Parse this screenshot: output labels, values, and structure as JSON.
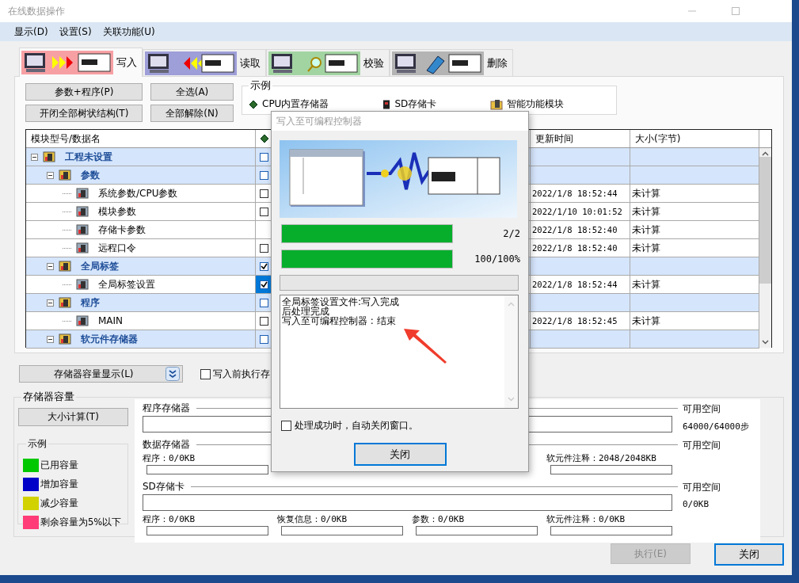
{
  "window": {
    "title": "在线数据操作"
  },
  "menu": [
    "显示(D)",
    "设置(S)",
    "关联功能(U)"
  ],
  "tabs": [
    {
      "label": "写入",
      "kind": "write",
      "color": "#f7a0a4",
      "selected": true
    },
    {
      "label": "读取",
      "kind": "read",
      "color": "#9e9ed8",
      "selected": false
    },
    {
      "label": "校验",
      "kind": "verify",
      "color": "#a2d4a2",
      "selected": false
    },
    {
      "label": "删除",
      "kind": "delete",
      "color": "#b4b4b4",
      "selected": false
    }
  ],
  "buttons": [
    "参数+程序(P)",
    "全选(A)",
    "开闭全部树状结构(T)",
    "全部解除(N)"
  ],
  "legend": {
    "title": "示例",
    "items": [
      {
        "label": "CPU内置存储器",
        "kind": "cpu"
      },
      {
        "label": "SD存储卡",
        "kind": "sd"
      },
      {
        "label": "智能功能模块",
        "kind": "module"
      }
    ]
  },
  "tree": {
    "columns": [
      "模块型号/数据名",
      "更新时间",
      "大小(字节)"
    ],
    "rows": [
      {
        "name": "工程未设置",
        "kind": "group",
        "expanded": true,
        "checked": false,
        "selected": false,
        "children": [
          {
            "name": "参数",
            "kind": "group",
            "expanded": true,
            "checked": false,
            "selected": false,
            "children": [
              {
                "name": "系统参数/CPU参数",
                "kind": "item",
                "checked": false,
                "selected": false,
                "updated": "2022/1/8 18:52:44",
                "size": "未计算"
              },
              {
                "name": "模块参数",
                "kind": "item",
                "checked": false,
                "selected": false,
                "updated": "2022/1/10 10:01:52",
                "size": "未计算"
              },
              {
                "name": "存储卡参数",
                "kind": "item",
                "selected": false,
                "updated": "2022/1/8 18:52:40",
                "size": "未计算"
              },
              {
                "name": "远程口令",
                "kind": "item",
                "checked": false,
                "selected": false,
                "updated": "2022/1/8 18:52:40",
                "size": "未计算"
              }
            ]
          },
          {
            "name": "全局标签",
            "kind": "group",
            "expanded": true,
            "checked": true,
            "selected": false,
            "children": [
              {
                "name": "全局标签设置",
                "kind": "item",
                "checked": true,
                "selected": true,
                "updated": "2022/1/8 18:52:44",
                "size": "未计算"
              }
            ]
          },
          {
            "name": "程序",
            "kind": "group",
            "expanded": true,
            "checked": false,
            "selected": false,
            "children": [
              {
                "name": "MAIN",
                "kind": "item",
                "checked": false,
                "selected": false,
                "updated": "2022/1/8 18:52:45",
                "size": "未计算"
              }
            ]
          },
          {
            "name": "软元件存储器",
            "kind": "group",
            "expanded": true,
            "checked": false,
            "selected": false
          }
        ]
      }
    ]
  },
  "capacity_toggle": {
    "label": "存储器容量显示(L)"
  },
  "pre_write_option": {
    "label": "写入前执行存",
    "checked": false
  },
  "capacity": {
    "title": "存储器容量",
    "calc_button": "大小计算(T)",
    "legend": {
      "title": "示例",
      "items": [
        {
          "label": "已用容量",
          "color": "#00c800"
        },
        {
          "label": "增加容量",
          "color": "#0000c8"
        },
        {
          "label": "减少容量",
          "color": "#d2d200"
        },
        {
          "label": "剩余容量为5%以下",
          "color": "#ff3c78"
        }
      ]
    },
    "sections": [
      {
        "title": "程序存储器",
        "kind": "bar",
        "free_label": "可用空间",
        "free_value": "64000/64000步"
      },
      {
        "title": "数据存储器",
        "kind": "list",
        "free_label": "可用空间",
        "items": [
          {
            "label": "程序：0/0KB"
          },
          {
            "label": "软元件注释：2048/2048KB"
          }
        ]
      },
      {
        "title": "SD存储卡",
        "kind": "bar",
        "free_label": "可用空间",
        "free_value": "0/0KB",
        "items": [
          {
            "label": "程序：0/0KB"
          },
          {
            "label": "恢复信息：0/0KB"
          },
          {
            "label": "参数：0/0KB"
          },
          {
            "label": "软元件注释：0/0KB"
          }
        ]
      }
    ]
  },
  "footer": {
    "execute": {
      "label": "执行(E)",
      "disabled": true
    },
    "close": {
      "label": "关闭"
    }
  },
  "dialog": {
    "title": "写入至可编程控制器",
    "progress": [
      {
        "level": 1,
        "reading": "2/2"
      },
      {
        "level": 1,
        "reading": "100/100%"
      }
    ],
    "log": [
      "全局标签设置文件:写入完成",
      "后处理完成",
      "写入至可编程控制器 : 结束"
    ],
    "auto_close": {
      "label": "处理成功时，自动关闭窗口。",
      "checked": false
    },
    "close_button": "关闭"
  }
}
